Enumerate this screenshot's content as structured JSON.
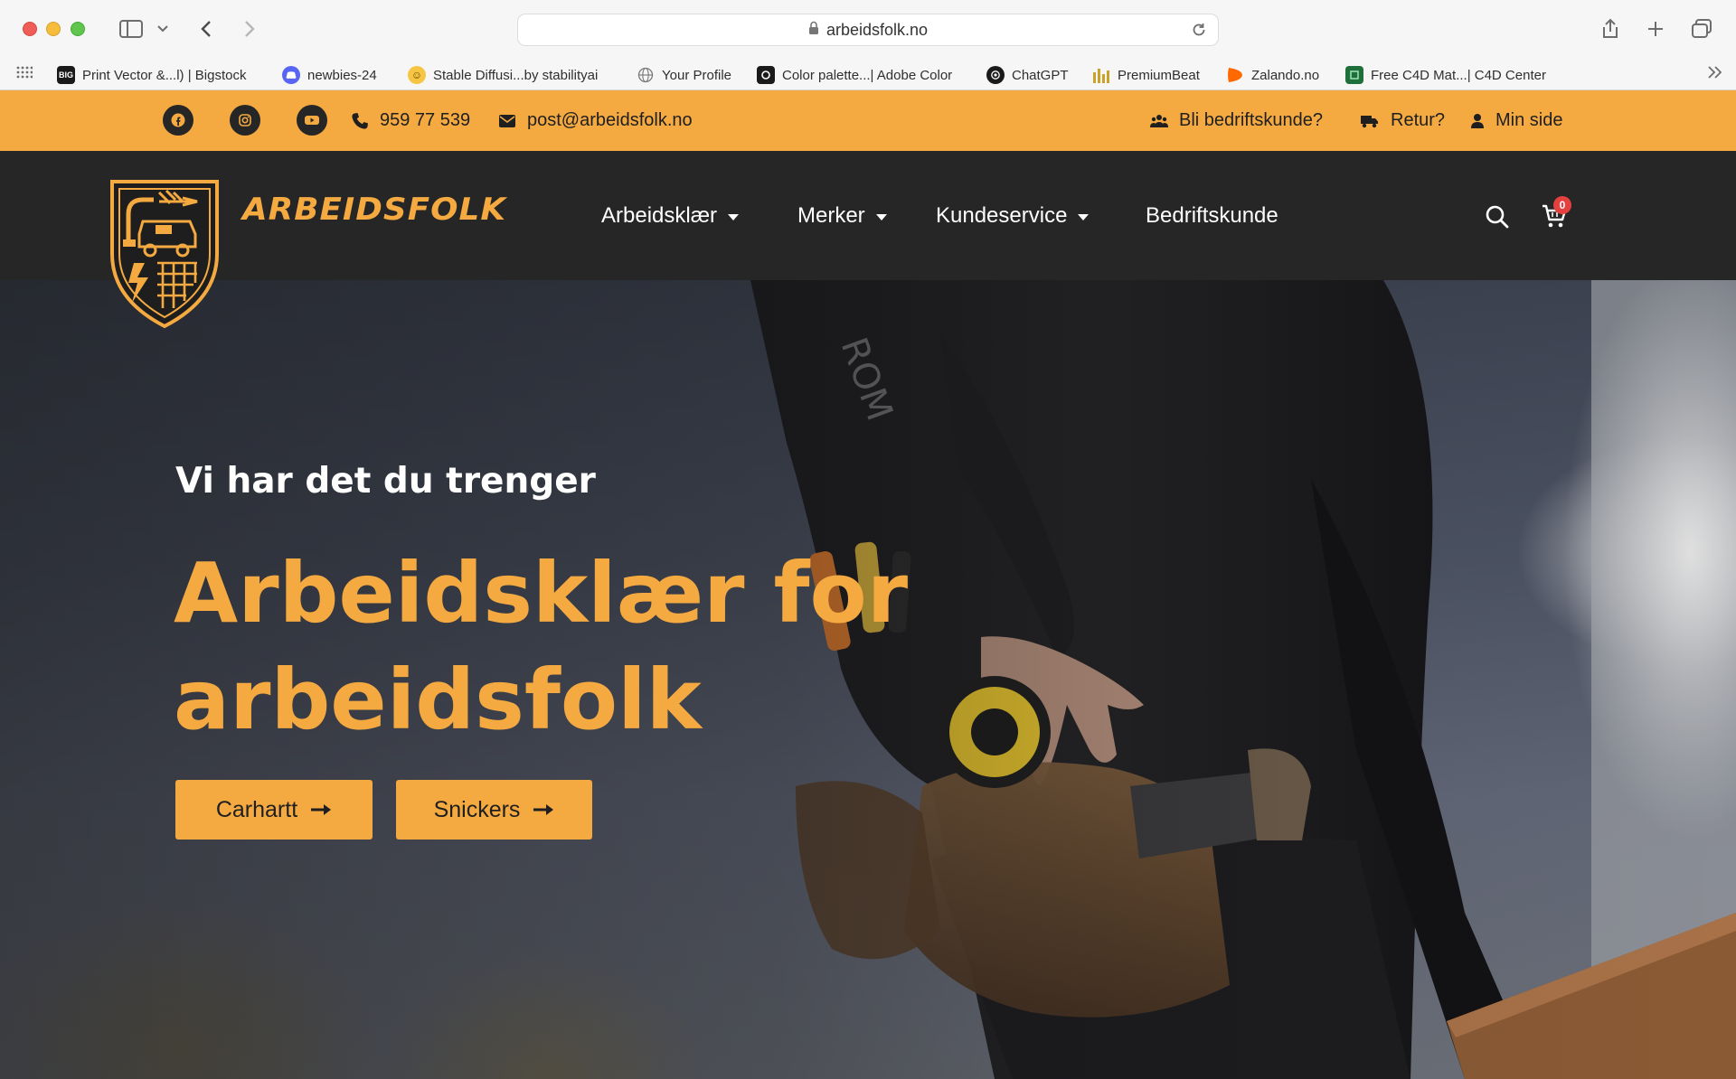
{
  "browser": {
    "url": "arbeidsfolk.no",
    "bookmarks": [
      {
        "label": "Print Vector &...l) | Bigstock",
        "icon": "bigstock-icon",
        "color": "#1a1a1a"
      },
      {
        "label": "newbies-24",
        "icon": "discord-icon",
        "color": "#5865f2"
      },
      {
        "label": "Stable Diffusi...by stabilityai",
        "icon": "huggingface-icon",
        "color": "#f6c544"
      },
      {
        "label": "Your Profile",
        "icon": "globe-icon",
        "color": "#888888"
      },
      {
        "label": "Color palette...| Adobe Color",
        "icon": "adobe-color-icon",
        "color": "#1a1a1a"
      },
      {
        "label": "ChatGPT",
        "icon": "chatgpt-icon",
        "color": "#1a1a1a"
      },
      {
        "label": "PremiumBeat",
        "icon": "premiumbeat-icon",
        "color": "#c9a227"
      },
      {
        "label": "Zalando.no",
        "icon": "zalando-icon",
        "color": "#ff6900"
      },
      {
        "label": "Free C4D Mat...| C4D Center",
        "icon": "c4d-center-icon",
        "color": "#1e6f3a"
      }
    ]
  },
  "topbar": {
    "phone": "959 77 539",
    "email": "post@arbeidsfolk.no",
    "business_link": "Bli bedriftskunde?",
    "return_link": "Retur?",
    "account_link": "Min side",
    "social": [
      "facebook-icon",
      "instagram-icon",
      "youtube-icon"
    ]
  },
  "header": {
    "brand": "ARBEIDSFOLK",
    "nav": [
      {
        "label": "Arbeidsklær",
        "dropdown": true
      },
      {
        "label": "Merker",
        "dropdown": true
      },
      {
        "label": "Kundeservice",
        "dropdown": true
      },
      {
        "label": "Bedriftskunde",
        "dropdown": false
      }
    ],
    "cart_count": "0"
  },
  "hero": {
    "subtitle": "Vi har det du trenger",
    "title_line1": "Arbeidsklær for",
    "title_line2": "arbeidsfolk",
    "buttons": [
      "Carhartt",
      "Snickers"
    ]
  },
  "colors": {
    "accent": "#f4aa41",
    "dark": "#262626"
  }
}
